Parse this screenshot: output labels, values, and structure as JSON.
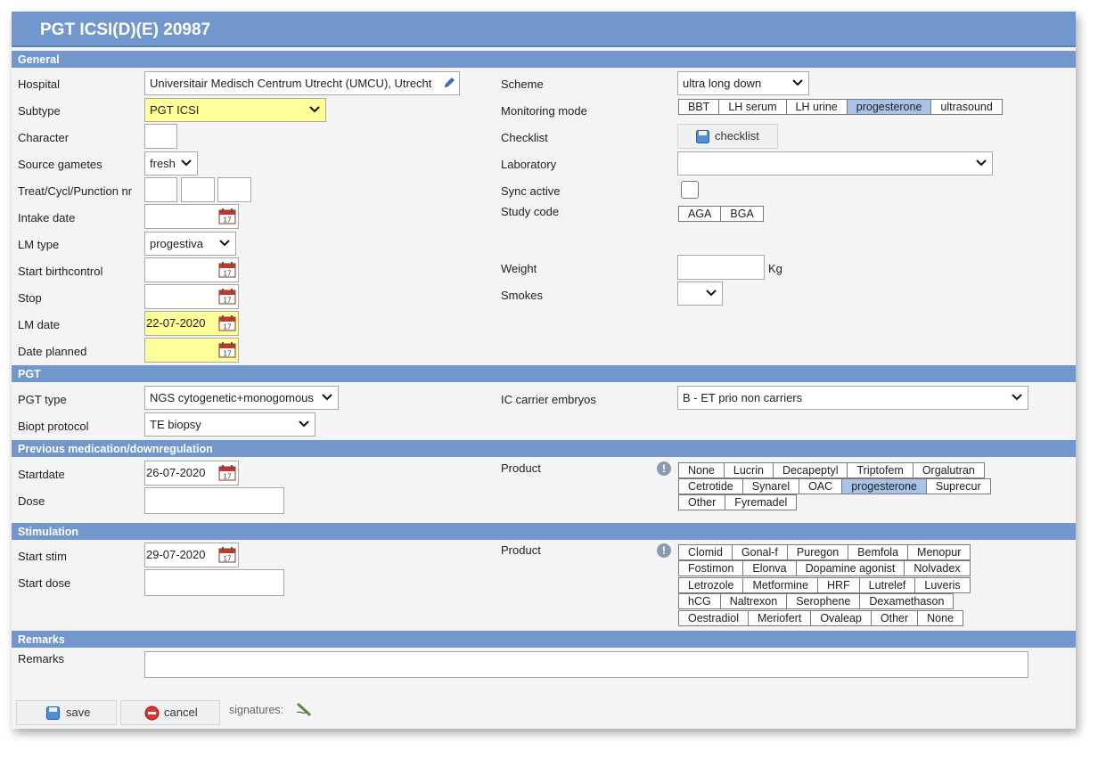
{
  "title": "PGT ICSI(D)(E) 20987",
  "sections": {
    "general": "General",
    "pgt": "PGT",
    "prev_med": "Previous medication/downregulation",
    "stimulation": "Stimulation",
    "remarks": "Remarks"
  },
  "general": {
    "hospital_label": "Hospital",
    "hospital_value": "Universitair Medisch Centrum Utrecht (UMCU), Utrecht",
    "subtype_label": "Subtype",
    "subtype_value": "PGT ICSI",
    "character_label": "Character",
    "character_value": "",
    "source_gametes_label": "Source gametes",
    "source_gametes_value": "fresh",
    "treat_label": "Treat/Cycl/Punction nr",
    "intake_date_label": "Intake date",
    "intake_date_value": "",
    "lm_type_label": "LM type",
    "lm_type_value": "progestiva",
    "start_birthcontrol_label": "Start birthcontrol",
    "stop_label": "Stop",
    "lm_date_label": "LM date",
    "lm_date_value": "22-07-2020",
    "date_planned_label": "Date planned",
    "date_planned_value": "",
    "scheme_label": "Scheme",
    "scheme_value": "ultra long down",
    "monitoring_label": "Monitoring mode",
    "monitoring_options": [
      "BBT",
      "LH serum",
      "LH urine",
      "progesterone",
      "ultrasound"
    ],
    "monitoring_selected": "progesterone",
    "checklist_label": "Checklist",
    "checklist_button": "checklist",
    "laboratory_label": "Laboratory",
    "laboratory_value": "",
    "sync_label": "Sync active",
    "study_code_label": "Study code",
    "study_codes": [
      "AGA",
      "BGA"
    ],
    "weight_label": "Weight",
    "weight_value": "",
    "weight_unit": "Kg",
    "smokes_label": "Smokes",
    "smokes_value": ""
  },
  "pgt": {
    "pgt_type_label": "PGT type",
    "pgt_type_value": "NGS cytogenetic+monogomous",
    "biopt_label": "Biopt protocol",
    "biopt_value": "TE biopsy",
    "ic_carrier_label": "IC carrier embryos",
    "ic_carrier_value": "B - ET prio non carriers"
  },
  "prev_med": {
    "startdate_label": "Startdate",
    "startdate_value": "26-07-2020",
    "dose_label": "Dose",
    "dose_value": "",
    "product_label": "Product",
    "product_rows": [
      [
        "None",
        "Lucrin",
        "Decapeptyl",
        "Triptofem",
        "Orgalutran"
      ],
      [
        "Cetrotide",
        "Synarel",
        "OAC",
        "progesterone",
        "Suprecur"
      ],
      [
        "Other",
        "Fyremadel"
      ]
    ],
    "product_selected": "progesterone"
  },
  "stimulation": {
    "start_stim_label": "Start stim",
    "start_stim_value": "29-07-2020",
    "start_dose_label": "Start dose",
    "start_dose_value": "",
    "product_label": "Product",
    "product_rows": [
      [
        "Clomid",
        "Gonal-f",
        "Puregon",
        "Bemfola",
        "Menopur"
      ],
      [
        "Fostimon",
        "Elonva",
        "Dopamine agonist",
        "Nolvadex"
      ],
      [
        "Letrozole",
        "Metformine",
        "HRF",
        "Lutrelef",
        "Luveris"
      ],
      [
        "hCG",
        "Naltrexon",
        "Serophene",
        "Dexamethason"
      ],
      [
        "Oestradiol",
        "Meriofert",
        "Ovaleap",
        "Other",
        "None"
      ]
    ]
  },
  "remarks": {
    "label": "Remarks",
    "value": ""
  },
  "footer": {
    "save": "save",
    "cancel": "cancel",
    "signatures": "signatures:"
  },
  "colors": {
    "header_blue": "#7197cd",
    "highlight_yellow": "#ffff99",
    "selected_blue": "#a9c2e8"
  }
}
